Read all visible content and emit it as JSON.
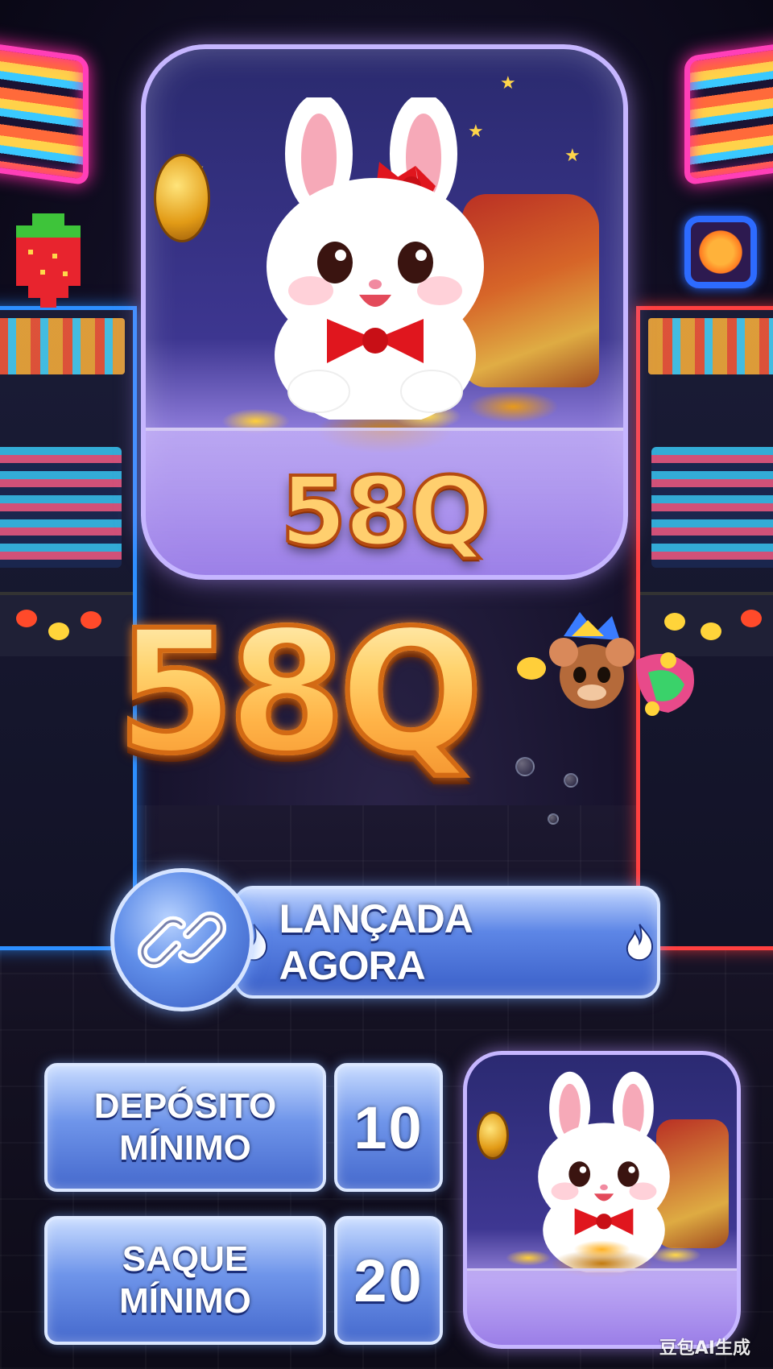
{
  "hero": {
    "code": "58Q",
    "mascot": "white-bunny-with-red-bow"
  },
  "title": {
    "code": "58Q"
  },
  "launch": {
    "label": "LANÇADA AGORA",
    "icon": "link-icon",
    "decoration": "flame-icon"
  },
  "info": {
    "deposit_label_line1": "DEPÓSITO",
    "deposit_label_line2": "MÍNIMO",
    "deposit_value": "10",
    "withdraw_label_line1": "SAQUE",
    "withdraw_label_line2": "MÍNIMO",
    "withdraw_value": "20"
  },
  "watermark": "豆包AI生成",
  "colors": {
    "gold": "#ffcf6e",
    "gold_stroke": "#d36a14",
    "tile_blue": "#4569cd",
    "card_purple": "#3d3690",
    "neon_pink": "#ff3fb8",
    "neon_blue": "#2d8fff"
  }
}
